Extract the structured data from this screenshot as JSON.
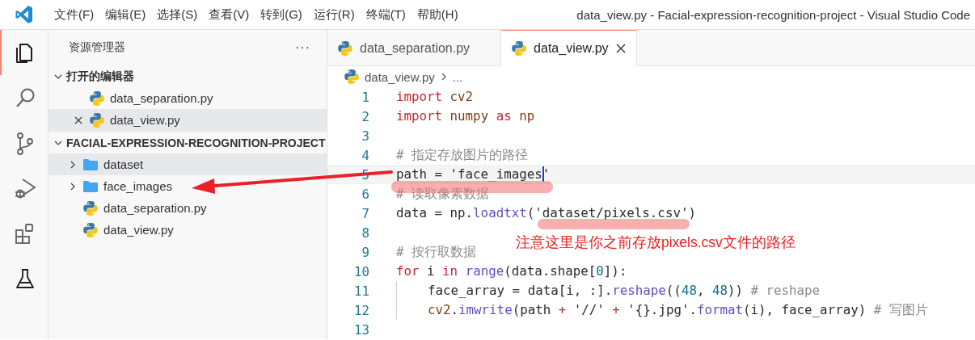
{
  "title_bar": {
    "menu": [
      "文件(F)",
      "编辑(E)",
      "选择(S)",
      "查看(V)",
      "转到(G)",
      "运行(R)",
      "终端(T)",
      "帮助(H)"
    ],
    "title": "data_view.py - Facial-expression-recognition-project - Visual Studio Code"
  },
  "activity_bar": [
    {
      "kind": "explorer",
      "selected": true
    },
    {
      "kind": "search",
      "selected": false
    },
    {
      "kind": "scm",
      "selected": false
    },
    {
      "kind": "debug",
      "selected": false
    },
    {
      "kind": "extensions",
      "selected": false
    },
    {
      "kind": "testing",
      "selected": false
    }
  ],
  "sidebar": {
    "title": "资源管理器",
    "more": "···",
    "sections": [
      {
        "title": "打开的编辑器",
        "kind": "open_editors",
        "expanded": true,
        "items": [
          {
            "name": "data_separation.py",
            "kind": "python",
            "selected": false,
            "closable": false
          },
          {
            "name": "data_view.py",
            "kind": "python",
            "selected": true,
            "closable": true
          }
        ]
      },
      {
        "title": "FACIAL-EXPRESSION-RECOGNITION-PROJECT",
        "kind": "folder",
        "expanded": true,
        "items": [
          {
            "name": "dataset",
            "kind": "folder",
            "selected": true,
            "expanded": false
          },
          {
            "name": "face_images",
            "kind": "folder",
            "selected": false,
            "expanded": false
          },
          {
            "name": "data_separation.py",
            "kind": "python",
            "selected": false
          },
          {
            "name": "data_view.py",
            "kind": "python",
            "selected": false
          }
        ]
      }
    ]
  },
  "tabs": [
    {
      "label": "data_separation.py",
      "selected": false
    },
    {
      "label": "data_view.py",
      "selected": true
    }
  ],
  "breadcrumb": {
    "file": "data_view.py",
    "rest": "..."
  },
  "code": [
    {
      "number": "1",
      "tokens": [
        {
          "kind": "kw",
          "text": "import"
        },
        {
          "kind": "mod",
          "text": " cv2"
        }
      ]
    },
    {
      "number": "2",
      "tokens": [
        {
          "kind": "kw",
          "text": "import"
        },
        {
          "kind": "mod",
          "text": " numpy"
        },
        {
          "kind": "kw",
          "text": " as"
        },
        {
          "kind": "mod",
          "text": " np"
        }
      ]
    },
    {
      "number": "3"
    },
    {
      "number": "4",
      "tokens": [
        {
          "kind": "cm",
          "text": "# 指定存放图片的路径"
        }
      ]
    },
    {
      "number": "5",
      "current": true,
      "tokens": [
        {
          "kind": "p",
          "text": "path = 'face_images"
        },
        {
          "kind": "p",
          "text": "'",
          "cursor": true
        }
      ]
    },
    {
      "number": "6",
      "tokens": [
        {
          "kind": "cm",
          "text": "# 读取像素数据"
        }
      ]
    },
    {
      "number": "7",
      "tokens": [
        {
          "kind": "p",
          "text": "data = np."
        },
        {
          "kind": "fn",
          "text": "loadtxt"
        },
        {
          "kind": "p",
          "text": "('dataset/pixels.csv')"
        }
      ]
    },
    {
      "number": "8"
    },
    {
      "number": "9",
      "tokens": [
        {
          "kind": "cm",
          "text": "# 按行取数据"
        }
      ]
    },
    {
      "number": "10",
      "tokens": [
        {
          "kind": "kw",
          "text": "for"
        },
        {
          "kind": "p",
          "text": " i "
        },
        {
          "kind": "kw",
          "text": "in"
        },
        {
          "kind": "fn",
          "text": " range"
        },
        {
          "kind": "p",
          "text": "(data.shape["
        },
        {
          "kind": "num",
          "text": "0"
        },
        {
          "kind": "p",
          "text": "]):"
        }
      ],
      "children": [
        {
          "number": "11",
          "tokens": [
            {
              "kind": "p",
              "text": "face_array = data[i, :]."
            },
            {
              "kind": "fn",
              "text": "reshape"
            },
            {
              "kind": "p",
              "text": "(("
            },
            {
              "kind": "num",
              "text": "48"
            },
            {
              "kind": "p",
              "text": ", "
            },
            {
              "kind": "num",
              "text": "48"
            },
            {
              "kind": "p",
              "text": ")) "
            },
            {
              "kind": "cm",
              "text": "# reshape"
            }
          ]
        },
        {
          "number": "12",
          "tokens": [
            {
              "kind": "mod",
              "text": "cv2"
            },
            {
              "kind": "p",
              "text": "."
            },
            {
              "kind": "fn",
              "text": "imwrite"
            },
            {
              "kind": "p",
              "text": "(path "
            },
            {
              "kind": "kw",
              "text": "+"
            },
            {
              "kind": "p",
              "text": " '//' "
            },
            {
              "kind": "kw",
              "text": "+"
            },
            {
              "kind": "p",
              "text": " '{}.jpg'."
            },
            {
              "kind": "fn",
              "text": "format"
            },
            {
              "kind": "p",
              "text": "(i), face_array) "
            },
            {
              "kind": "cm",
              "text": "# 写图片"
            }
          ]
        }
      ]
    },
    {
      "number": "13"
    }
  ],
  "annotation": {
    "note": "注意这里是你之前存放pixels.csv文件的路径"
  }
}
